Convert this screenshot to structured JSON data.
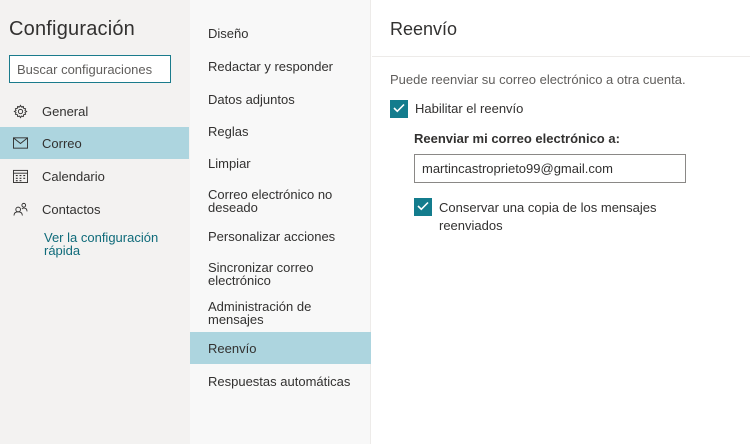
{
  "left": {
    "title": "Configuración",
    "search_placeholder": "Buscar configuraciones",
    "nav": [
      {
        "label": "General",
        "icon": "gear-icon"
      },
      {
        "label": "Correo",
        "icon": "mail-icon",
        "selected": true
      },
      {
        "label": "Calendario",
        "icon": "calendar-icon"
      },
      {
        "label": "Contactos",
        "icon": "people-icon"
      }
    ],
    "quick_settings_link": "Ver la configuración rápida"
  },
  "middle": {
    "items": [
      "Diseño",
      "Redactar y responder",
      "Datos adjuntos",
      "Reglas",
      "Limpiar",
      "Correo electrónico no deseado",
      "Personalizar acciones",
      "Sincronizar correo electrónico",
      "Administración de mensajes",
      "Reenvío",
      "Respuestas automáticas"
    ],
    "selected": "Reenvío"
  },
  "right": {
    "title": "Reenvío",
    "description": "Puede reenviar su correo electrónico a otra cuenta.",
    "enable_forwarding": {
      "label": "Habilitar el reenvío",
      "checked": true
    },
    "forward_to_label": "Reenviar mi correo electrónico a:",
    "forward_to_value": "martincastroprieto99@gmail.com",
    "keep_copy": {
      "label": "Conservar una copia de los mensajes reenviados",
      "checked": true
    }
  },
  "colors": {
    "accent": "#137c8d",
    "selected_bg": "#add5df",
    "link": "#0f6b7a"
  }
}
